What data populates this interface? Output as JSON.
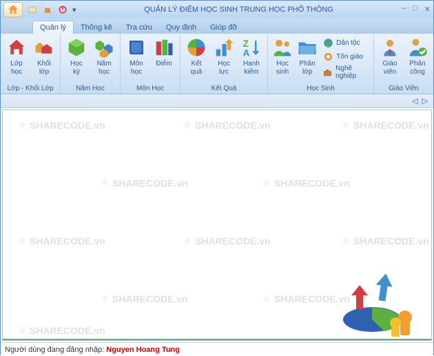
{
  "title": "QUẢN LÝ ĐIỂM HỌC SINH TRUNG HỌC PHỔ THÔNG",
  "tabs": {
    "quanly": "Quản lý",
    "thongke": "Thống kê",
    "tracuu": "Tra cứu",
    "quydinh": "Quy định",
    "giupdo": "Giúp đỡ"
  },
  "ribbon": {
    "group1": {
      "label": "Lớp - Khối Lớp",
      "lop": "Lớp\nhọc",
      "khoi": "Khối\nlớp"
    },
    "group2": {
      "label": "Năm Học",
      "hocky": "Học\nkỳ",
      "namhoc": "Năm\nhọc"
    },
    "group3": {
      "label": "Môn Học",
      "mon": "Môn\nhọc",
      "diem": "Điểm"
    },
    "group4": {
      "label": "Kết Quả",
      "ketqua": "Kết\nquả",
      "hocluc": "Học\nlực",
      "hanhkiem": "Hạnh\nkiểm"
    },
    "group5": {
      "label": "Học Sinh",
      "hocsinh": "Học\nsinh",
      "phanlop": "Phân\nlớp",
      "dantoc": "Dân tộc",
      "tongiao": "Tôn giáo",
      "nghenghiep": "Nghề nghiệp"
    },
    "group6": {
      "label": "Giáo Viên",
      "giaovien": "Giáo\nviên",
      "phancong": "Phân\ncông"
    }
  },
  "watermark": "SHARECODE.vn",
  "statusbar": {
    "label": "Người dùng đang đăng nhập:",
    "user": "Nguyen Hoang Tung"
  }
}
